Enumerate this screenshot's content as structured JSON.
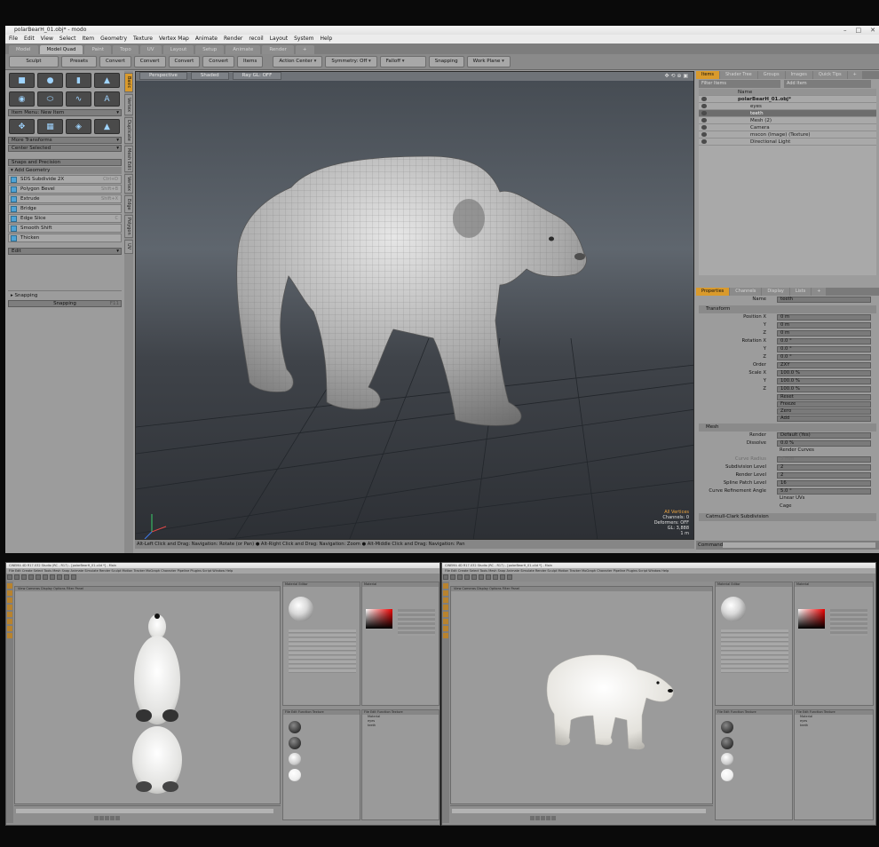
{
  "modo": {
    "window_title": "polarBearH_01.obj* - modo",
    "win_buttons": [
      "–",
      "□",
      "✕"
    ],
    "menu": [
      "File",
      "Edit",
      "View",
      "Select",
      "Item",
      "Geometry",
      "Texture",
      "Vertex Map",
      "Animate",
      "Render",
      "recoil",
      "Layout",
      "System",
      "Help"
    ],
    "layout_tabs": [
      "Model",
      "Model Quad",
      "Paint",
      "Topo",
      "UV",
      "Layout",
      "Setup",
      "Animate",
      "Render",
      "+"
    ],
    "active_layout_tab": "Model Quad",
    "toolbar": {
      "sculpt": "Sculpt",
      "presets": "Presets",
      "convert": [
        "Convert",
        "Convert",
        "Convert",
        "Convert"
      ],
      "items": "Items",
      "action_center": "Action Center",
      "symmetry": "Symmetry: Off",
      "falloff": "Falloff",
      "snapping": "Snapping",
      "work_plane": "Work Plane"
    },
    "left_panel": {
      "item_menu": "Item Menu: New Item",
      "more_transforms": "More Transforms",
      "center_selected": "Center Selected",
      "snaps_precision": "Snaps and Precision",
      "add_geometry": "Add Geometry",
      "tools": [
        {
          "label": "SDS Subdivide 2X",
          "key": "Ctrl+D"
        },
        {
          "label": "Polygon Bevel",
          "key": "Shift+B"
        },
        {
          "label": "Extrude",
          "key": "Shift+X"
        },
        {
          "label": "Bridge",
          "key": ""
        },
        {
          "label": "Edge Slice",
          "key": "C"
        },
        {
          "label": "Smooth Shift",
          "key": ""
        },
        {
          "label": "Thicken",
          "key": ""
        }
      ],
      "edit": "Edit",
      "snapping_section": "Snapping",
      "snapping_button": "Snapping",
      "snapping_key": "F11"
    },
    "vertical_tabs": [
      "Basic",
      "Vertex",
      "Duplicate",
      "Mesh Edit",
      "Vertex",
      "Edge",
      "Polygon",
      "UV"
    ],
    "viewport": {
      "view": "Perspective",
      "shading": "Shaded",
      "raygl": "Ray GL: OFF",
      "info": [
        "All Vertices",
        "Channels: 0",
        "Deformers: OFF",
        "GL: 3,888",
        "1 m"
      ]
    },
    "status_hint": "Alt-Left Click and Drag: Navigation: Rotate (or Pan) ● Alt-Right Click and Drag: Navigation: Zoom ● Alt-Middle Click and Drag: Navigation: Pan",
    "right_panel": {
      "tabs": [
        "Items",
        "Shader Tree",
        "Groups",
        "Images",
        "Quick Tips",
        "+"
      ],
      "filter": "Filter Items",
      "add_item": "Add Item",
      "tree_header": "Name",
      "tree": [
        {
          "label": "polarBearH_01.obj*",
          "indent": 0
        },
        {
          "label": "eyes",
          "indent": 1
        },
        {
          "label": "teeth",
          "indent": 1
        },
        {
          "label": "Mesh (2)",
          "indent": 1
        },
        {
          "label": "Camera",
          "indent": 1
        },
        {
          "label": "mscon (Image) (Texture)",
          "indent": 1
        },
        {
          "label": "Directional Light",
          "indent": 1
        }
      ],
      "prop_tabs": [
        "Properties",
        "Channels",
        "Display",
        "Lists",
        "+"
      ],
      "name_label": "Name",
      "name_value": "teeth",
      "transform_header": "Transform",
      "props": [
        {
          "label": "Position X",
          "value": "0 m"
        },
        {
          "label": "Y",
          "value": "0 m"
        },
        {
          "label": "Z",
          "value": "0 m"
        },
        {
          "label": "Rotation X",
          "value": "0.0 °"
        },
        {
          "label": "Y",
          "value": "0.0 °"
        },
        {
          "label": "Z",
          "value": "0.0 °"
        },
        {
          "label": "Order",
          "value": "ZXY"
        },
        {
          "label": "Scale X",
          "value": "100.0 %"
        },
        {
          "label": "Y",
          "value": "100.0 %"
        },
        {
          "label": "Z",
          "value": "100.0 %"
        }
      ],
      "actions": [
        "Reset",
        "Freeze",
        "Zero",
        "Add"
      ],
      "mesh_header": "Mesh",
      "mesh_props": [
        {
          "label": "Render",
          "value": "Default (Yes)"
        },
        {
          "label": "Dissolve",
          "value": "0.0 %"
        },
        {
          "label": "",
          "value": "Render Curves"
        },
        {
          "label": "Curve Radius",
          "value": "5 mm"
        },
        {
          "label": "Subdivision Level",
          "value": "2"
        },
        {
          "label": "Render Level",
          "value": "2"
        },
        {
          "label": "Spline Patch Level",
          "value": "16"
        },
        {
          "label": "Curve Refinement Angle",
          "value": "5.0 °"
        }
      ],
      "checkboxes": [
        "Linear UVs",
        "Cage"
      ],
      "catmull_header": "Catmull-Clark Subdivision",
      "side_tabs": [
        "Mesh",
        "User Channels",
        "Tags"
      ]
    },
    "command_label": "Command"
  },
  "c4d": {
    "title_left": "CINEMA 4D R17.032 Studio (RC - R17) - [polarBearH_01.c4d *] - Main",
    "title_right": "CINEMA 4D R17.032 Studio (RC - R17) - [polarBearH_01.c4d *] - Main",
    "menu": "File Edit Create Select Tools Mesh Snap Animate Simulate Render Sculpt Motion Tracker MoGraph Character Pipeline Plugins Script Window Help",
    "viewport_menu": "View Cameras Display Options Filter Panel",
    "attributes": "Material Editor",
    "material_name": "Material",
    "object_panel": "File Edit Function Texture",
    "object_names": [
      "Material",
      "eyes",
      "teeth"
    ]
  }
}
